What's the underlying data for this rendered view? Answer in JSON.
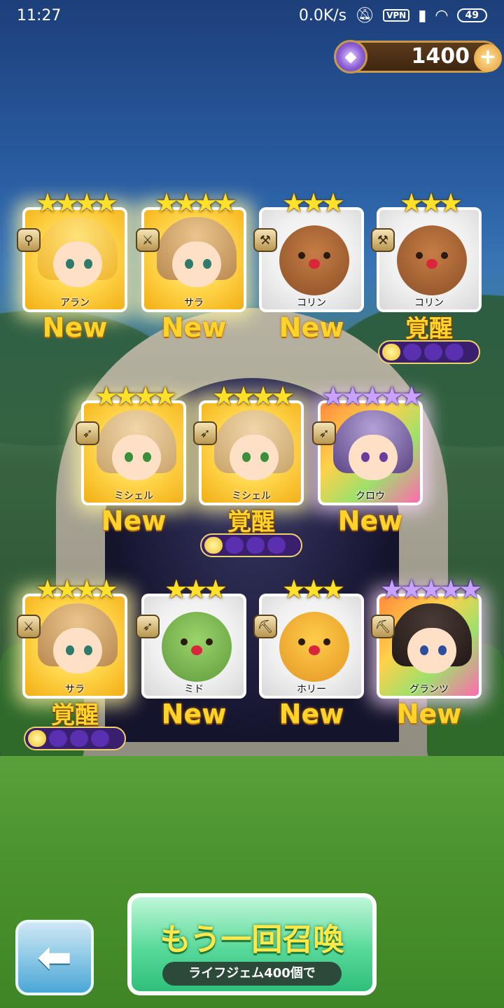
{
  "status_bar": {
    "time": "11:27",
    "network_speed": "0.0K/s",
    "vpn": "VPN",
    "battery": "49"
  },
  "currency": {
    "value": "1400",
    "icon": "gem-icon"
  },
  "cards": [
    {
      "name": "アラン",
      "stars": 4,
      "star_color": "gold",
      "badge": "New",
      "role_icon": "ladle-icon"
    },
    {
      "name": "サラ",
      "stars": 4,
      "star_color": "gold",
      "badge": "New",
      "role_icon": "sword-icon"
    },
    {
      "name": "コリン",
      "stars": 3,
      "star_color": "gold",
      "badge": "New",
      "role_icon": "axe-icon"
    },
    {
      "name": "コリン",
      "stars": 3,
      "star_color": "gold",
      "badge": "覚醒",
      "role_icon": "axe-icon"
    },
    {
      "name": "ミシェル",
      "stars": 4,
      "star_color": "gold",
      "badge": "New",
      "role_icon": "bow-icon"
    },
    {
      "name": "ミシェル",
      "stars": 4,
      "star_color": "gold",
      "badge": "覚醒",
      "role_icon": "bow-icon"
    },
    {
      "name": "クロウ",
      "stars": 5,
      "star_color": "purple",
      "badge": "New",
      "role_icon": "bow-icon"
    },
    {
      "name": "サラ",
      "stars": 4,
      "star_color": "gold",
      "badge": "覚醒",
      "role_icon": "sword-icon"
    },
    {
      "name": "ミド",
      "stars": 3,
      "star_color": "gold",
      "badge": "New",
      "role_icon": "bow-icon"
    },
    {
      "name": "ホリー",
      "stars": 3,
      "star_color": "gold",
      "badge": "New",
      "role_icon": "pickaxe-icon"
    },
    {
      "name": "グランツ",
      "stars": 5,
      "star_color": "purple",
      "badge": "New",
      "role_icon": "pickaxe-icon"
    }
  ],
  "buttons": {
    "back_icon": "back-arrow-icon",
    "summon_again_label": "もう一回召喚",
    "summon_cost_label": "ライフジェム400個で"
  }
}
